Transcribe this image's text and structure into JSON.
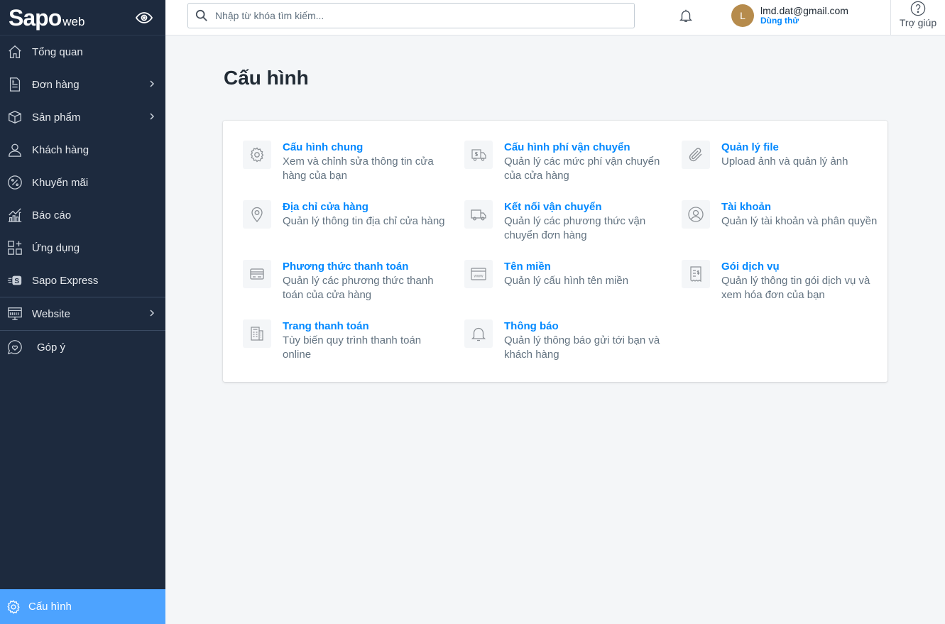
{
  "brand": {
    "logo_main": "Sapo",
    "logo_sub": "web"
  },
  "sidebar": {
    "items": [
      {
        "label": "Tổng quan",
        "icon": "home-icon"
      },
      {
        "label": "Đơn hàng",
        "icon": "order-icon"
      },
      {
        "label": "Sản phẩm",
        "icon": "box-icon"
      },
      {
        "label": "Khách hàng",
        "icon": "user-icon"
      },
      {
        "label": "Khuyến mãi",
        "icon": "percent-icon"
      },
      {
        "label": "Báo cáo",
        "icon": "chart-icon"
      },
      {
        "label": "Ứng dụng",
        "icon": "apps-icon"
      },
      {
        "label": "Sapo Express",
        "icon": "sapo-express-icon"
      },
      {
        "label": "Website",
        "icon": "website-icon"
      },
      {
        "label": "Góp ý",
        "icon": "feedback-icon"
      }
    ],
    "active": {
      "label": "Cấu hình",
      "icon": "gear-icon"
    }
  },
  "topbar": {
    "search_placeholder": "Nhập từ khóa tìm kiếm...",
    "user_initial": "L",
    "user_email": "lmd.dat@gmail.com",
    "user_plan": "Dùng thử",
    "help_label": "Trợ giúp"
  },
  "page": {
    "title": "Cấu hình"
  },
  "settings": [
    {
      "title": "Cấu hình chung",
      "desc": "Xem và chỉnh sửa thông tin cửa hàng của bạn",
      "icon": "gear-icon"
    },
    {
      "title": "Cấu hình phí vận chuyển",
      "desc": "Quản lý các mức phí vận chuyển của cửa hàng",
      "icon": "shipping-fee-icon"
    },
    {
      "title": "Quản lý file",
      "desc": "Upload ảnh và quản lý ảnh",
      "icon": "paperclip-icon"
    },
    {
      "title": "Địa chỉ cửa hàng",
      "desc": "Quản lý thông tin địa chỉ cửa hàng",
      "icon": "location-pin-icon"
    },
    {
      "title": "Kết nối vận chuyển",
      "desc": "Quản lý các phương thức vận chuyển đơn hàng",
      "icon": "truck-icon"
    },
    {
      "title": "Tài khoản",
      "desc": "Quản lý tài khoản và phân quyền",
      "icon": "account-icon"
    },
    {
      "title": "Phương thức thanh toán",
      "desc": "Quản lý các phương thức thanh toán của cửa hàng",
      "icon": "credit-card-icon"
    },
    {
      "title": "Tên miền",
      "desc": "Quản lý cấu hình tên miền",
      "icon": "www-icon"
    },
    {
      "title": "Gói dịch vụ",
      "desc": "Quản lý thông tin gói dịch vụ và xem hóa đơn của bạn",
      "icon": "receipt-icon"
    },
    {
      "title": "Trang thanh toán",
      "desc": "Tùy biến quy trình thanh toán online",
      "icon": "checkout-page-icon"
    },
    {
      "title": "Thông báo",
      "desc": "Quản lý thông báo gửi tới bạn và khách hàng",
      "icon": "bell-icon"
    }
  ],
  "colors": {
    "sidebar_bg": "#1d2a3e",
    "accent": "#0088ff",
    "active_bg": "#4da3ff"
  }
}
